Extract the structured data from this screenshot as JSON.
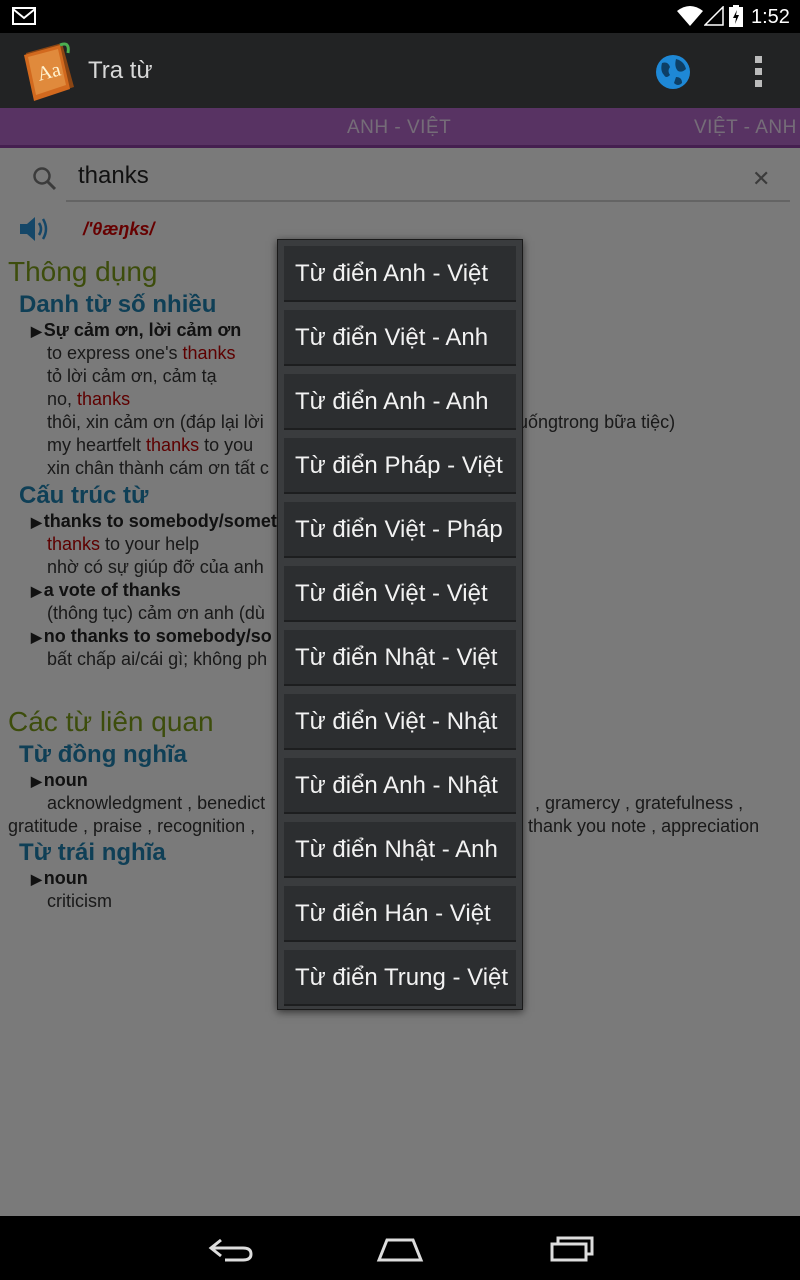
{
  "status_bar": {
    "time": "1:52"
  },
  "action_bar": {
    "title": "Tra từ"
  },
  "tabs": [
    "ANH - VIỆT",
    "VIỆT - ANH"
  ],
  "search": {
    "value": "thanks"
  },
  "entry": {
    "phonetic": "/'θæŋks/",
    "section_common": "Thông dụng",
    "noun_plural": "Danh từ số nhiều",
    "sense1": "Sự cảm ơn, lời cảm ơn",
    "ex1_pre": "to express one's ",
    "ex1_hl": "thanks",
    "ex1_tr": "tỏ lời cảm ơn, cảm tạ",
    "ex2_pre": "no, ",
    "ex2_hl": "thanks",
    "ex2_tr_a": "thôi, xin cảm ơn (đáp lại lời",
    "ex2_tr_b": "uốngtrong bữa tiệc)",
    "ex3_pre": "my heartfelt ",
    "ex3_hl": "thanks",
    "ex3_post": " to you",
    "ex3_tr": "xin chân thành cám ơn tất c",
    "structures": "Cấu trúc từ",
    "st1": "thanks to somebody/somet",
    "st1_ex_hl": "thanks",
    "st1_ex_post": " to your help",
    "st1_tr": "nhờ có sự giúp đỡ của anh",
    "st2": "a vote of thanks",
    "st2_tr": "(thông tục) cảm ơn anh (dù",
    "st3": "no thanks to somebody/so",
    "st3_tr": "bất chấp ai/cái gì; không ph",
    "related": "Các từ liên quan",
    "synonyms": "Từ đồng nghĩa",
    "syn_pos": "noun",
    "syn_line1_a": "acknowledgment , benedict",
    "syn_line1_b": ", gramercy , gratefulness ,",
    "syn_line2_a": "gratitude , praise , recognition ,",
    "syn_line2_b": "thank you note , appreciation",
    "antonyms": "Từ trái nghĩa",
    "ant_pos": "noun",
    "ant_line": "criticism"
  },
  "dictionary_menu": [
    "Từ điển Anh - Việt",
    "Từ điển Việt - Anh",
    "Từ điển Anh - Anh",
    "Từ điển Pháp - Việt",
    "Từ điển Việt - Pháp",
    "Từ điển Việt - Việt",
    "Từ điển Nhật - Việt",
    "Từ điển Việt - Nhật",
    "Từ điển Anh - Nhật",
    "Từ điển Nhật - Anh",
    "Từ điển Hán - Việt",
    "Từ điển Trung - Việt"
  ]
}
